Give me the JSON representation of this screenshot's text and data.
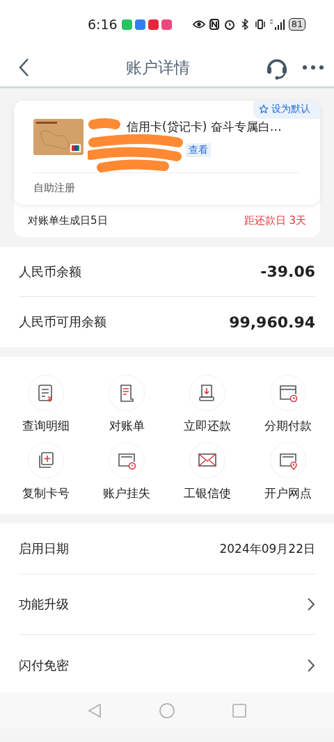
{
  "status_bar": {
    "time": "6:16",
    "battery": "81"
  },
  "header": {
    "title": "账户详情"
  },
  "card": {
    "default_button": "设为默认",
    "title": "信用卡(贷记卡) 奋斗专属白…",
    "view_link": "查看",
    "register": "自助注册",
    "statement_day": "对账单生成日5日",
    "due": "距还款日 3天"
  },
  "balances": [
    {
      "label": "人民币余额",
      "value": "-39.06"
    },
    {
      "label": "人民币可用余额",
      "value": "99,960.94"
    }
  ],
  "actions": [
    {
      "kind": "detail",
      "label": "查询明细"
    },
    {
      "kind": "statement",
      "label": "对账单"
    },
    {
      "kind": "repay",
      "label": "立即还款"
    },
    {
      "kind": "installment",
      "label": "分期付款"
    },
    {
      "kind": "copy",
      "label": "复制卡号"
    },
    {
      "kind": "lost",
      "label": "账户挂失"
    },
    {
      "kind": "mail",
      "label": "工银信使"
    },
    {
      "kind": "branch",
      "label": "开户网点"
    }
  ],
  "info_rows": [
    {
      "label": "启用日期",
      "value": "2024年09月22日",
      "chevron": false
    },
    {
      "label": "功能升级",
      "chevron": true
    },
    {
      "label": "闪付免密",
      "chevron": true
    }
  ]
}
